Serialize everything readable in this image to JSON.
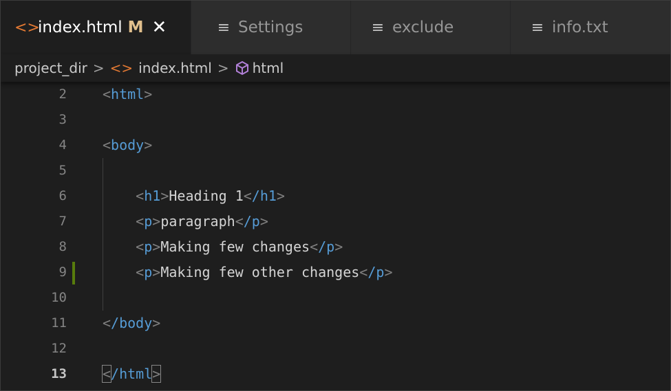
{
  "tabs": [
    {
      "label": "index.html",
      "icon": "html-file-icon",
      "modified": "M",
      "close": "✕",
      "active": true
    },
    {
      "label": "Settings",
      "icon": "lines-file-icon",
      "active": false
    },
    {
      "label": "exclude",
      "icon": "lines-file-icon",
      "active": false
    },
    {
      "label": "info.txt",
      "icon": "lines-file-icon",
      "active": false
    }
  ],
  "breadcrumb": {
    "folder": "project_dir",
    "file": "index.html",
    "symbol": "html",
    "separator": ">"
  },
  "editor": {
    "lines": [
      {
        "number": "2",
        "text": "<html>"
      },
      {
        "number": "3",
        "text": ""
      },
      {
        "number": "4",
        "text": "<body>"
      },
      {
        "number": "5",
        "text": ""
      },
      {
        "number": "6",
        "text": "    <h1>Heading 1</h1>"
      },
      {
        "number": "7",
        "text": "    <p>paragraph</p>"
      },
      {
        "number": "8",
        "text": "    <p>Making few changes</p>"
      },
      {
        "number": "9",
        "text": "    <p>Making few other changes</p>"
      },
      {
        "number": "10",
        "text": ""
      },
      {
        "number": "11",
        "text": "</body>"
      },
      {
        "number": "12",
        "text": ""
      },
      {
        "number": "13",
        "text": "</html>"
      }
    ],
    "current_line": "13"
  },
  "colors": {
    "tag": "#569cd6",
    "punctuation": "#808080",
    "modified_gutter": "#587c0c",
    "html_icon": "#e37933",
    "modified_badge": "#e2c08d"
  }
}
